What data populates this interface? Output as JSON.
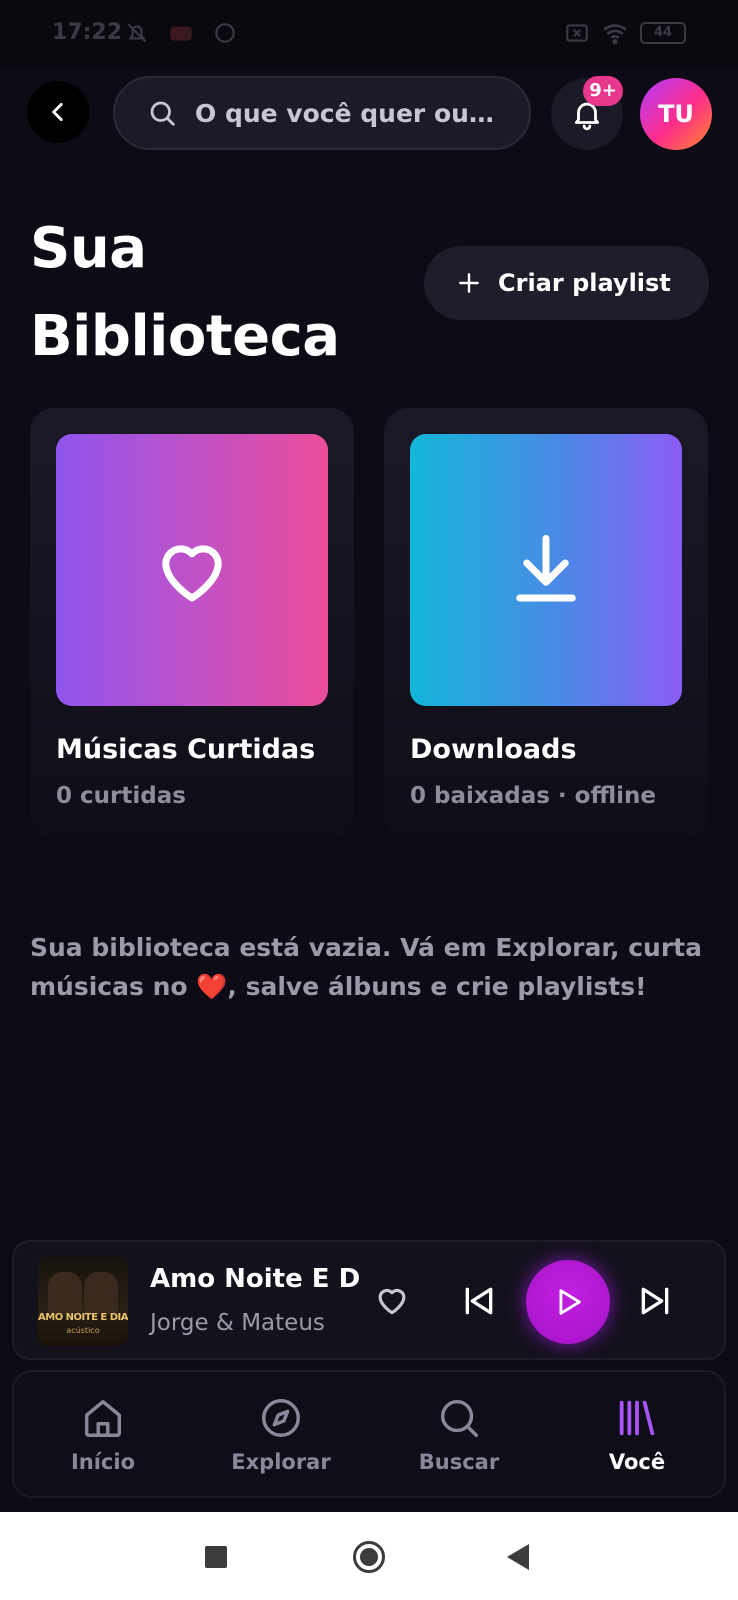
{
  "status_bar": {
    "time": "17:22",
    "battery": "44",
    "icons": [
      "bell-off-icon",
      "youtube-icon",
      "whatsapp-icon",
      "sim-off-icon",
      "wifi-icon",
      "battery-icon"
    ]
  },
  "header": {
    "search_placeholder": "O que você quer ou...",
    "notification_badge": "9+",
    "avatar_initials": "TU"
  },
  "page": {
    "title": "Sua Biblioteca",
    "create_playlist_label": "Criar playlist"
  },
  "cards": [
    {
      "title": "Músicas Curtidas",
      "subtitle": "0 curtidas",
      "icon": "heart-icon"
    },
    {
      "title": "Downloads",
      "subtitle": "0 baixadas · offline",
      "icon": "download-icon"
    }
  ],
  "empty_message": {
    "before": "Sua biblioteca está vazia. Vá em Explorar, curta músicas no ",
    "emoji": "❤️",
    "after": ", salve álbuns e crie playlists!"
  },
  "player": {
    "track": "Amo Noite E Di",
    "artist": "Jorge & Mateus",
    "cover_title": "AMO NOITE E DIA",
    "cover_subtitle": "acústico"
  },
  "nav": [
    {
      "label": "Início",
      "icon": "home-icon",
      "active": false
    },
    {
      "label": "Explorar",
      "icon": "compass-icon",
      "active": false
    },
    {
      "label": "Buscar",
      "icon": "search-icon",
      "active": false
    },
    {
      "label": "Você",
      "icon": "library-icon",
      "active": true
    }
  ],
  "colors": {
    "background": "#0d0b16",
    "accent_pink": "#e8388e",
    "accent_purple": "#a414c8",
    "library_active": "#a855f7"
  }
}
